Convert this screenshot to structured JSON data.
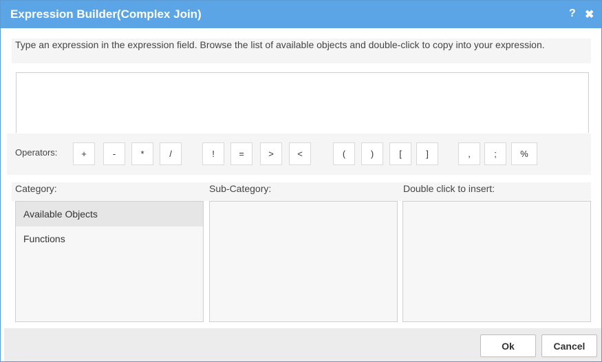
{
  "dialog": {
    "title": "Expression Builder(Complex Join)",
    "help_icon": "?",
    "close_icon": "✖"
  },
  "instruction": "Type an expression in the expression field. Browse the list of available objects and double-click to copy into your expression.",
  "expression": {
    "value": "",
    "placeholder": ""
  },
  "operators": {
    "label": "Operators:",
    "buttons": [
      "+",
      "-",
      "*",
      "/",
      "!",
      "=",
      ">",
      "<",
      "(",
      ")",
      "[",
      "]",
      ",",
      ";",
      "%"
    ]
  },
  "columns": {
    "category_header": "Category:",
    "subcategory_header": "Sub-Category:",
    "insert_header": "Double click to insert:"
  },
  "category": {
    "items": [
      {
        "label": "Available Objects",
        "selected": true
      },
      {
        "label": "Functions",
        "selected": false
      }
    ]
  },
  "footer": {
    "ok_label": "Ok",
    "cancel_label": "Cancel"
  },
  "colors": {
    "titlebar": "#5ba4e5",
    "selected_row": "#e6e6e6"
  }
}
